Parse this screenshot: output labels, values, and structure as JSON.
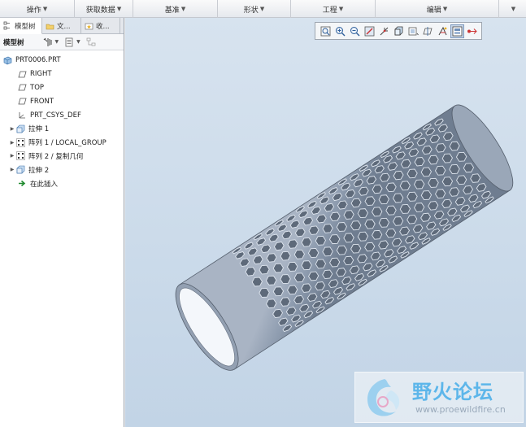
{
  "ribbon": {
    "groups": [
      "操作",
      "获取数据",
      "基准",
      "形状",
      "工程",
      "编辑"
    ]
  },
  "left_panel": {
    "tabs": [
      "模型树",
      "文...",
      "收..."
    ],
    "tree_label": "模型树",
    "tree": [
      {
        "label": "PRT0006.PRT",
        "icon": "part-icon",
        "expandable": false
      },
      {
        "label": "RIGHT",
        "icon": "datum-plane-icon",
        "expandable": false
      },
      {
        "label": "TOP",
        "icon": "datum-plane-icon",
        "expandable": false
      },
      {
        "label": "FRONT",
        "icon": "datum-plane-icon",
        "expandable": false
      },
      {
        "label": "PRT_CSYS_DEF",
        "icon": "csys-icon",
        "expandable": false
      },
      {
        "label": "拉伸 1",
        "icon": "extrude-icon",
        "expandable": true
      },
      {
        "label": "阵列 1 / LOCAL_GROUP",
        "icon": "pattern-icon",
        "expandable": true
      },
      {
        "label": "阵列 2 / 复制几何",
        "icon": "pattern-icon",
        "expandable": true
      },
      {
        "label": "拉伸 2",
        "icon": "extrude-icon",
        "expandable": true
      },
      {
        "label": "在此插入",
        "icon": "insert-here-icon",
        "expandable": false
      }
    ]
  },
  "view_toolbar": {
    "buttons": [
      "refit-icon",
      "zoom-in-icon",
      "zoom-out-icon",
      "repaint-icon",
      "spin-center-icon",
      "display-style-icon",
      "saved-views-icon",
      "datum-display-icon",
      "annotation-display-icon",
      "shading-icon",
      "appearance-icon"
    ],
    "active_index": 9
  },
  "watermark": {
    "title": "野火论坛",
    "url": "www.proewildfire.cn"
  },
  "colors": {
    "viewport_top": "#d7e3ef",
    "viewport_bottom": "#c2d4e6",
    "model": "#8f9db0",
    "watermark_text": "#5db6ea"
  }
}
